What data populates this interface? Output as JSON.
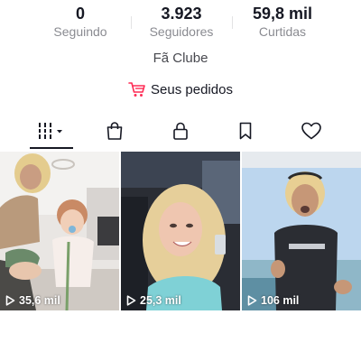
{
  "stats": [
    {
      "value": "0",
      "label": "Seguindo"
    },
    {
      "value": "3.923",
      "label": "Seguidores"
    },
    {
      "value": "59,8 mil",
      "label": "Curtidas"
    }
  ],
  "fan_club": "Fã Clube",
  "orders": {
    "label": "Seus pedidos",
    "icon": "cart-icon",
    "color": "#fe2c55"
  },
  "tabs": [
    {
      "name": "videos-grid",
      "icon": "grid-icon",
      "selected": true
    },
    {
      "name": "shop",
      "icon": "shopping-bag-icon"
    },
    {
      "name": "private",
      "icon": "lock-icon"
    },
    {
      "name": "saved",
      "icon": "bookmark-icon"
    },
    {
      "name": "liked",
      "icon": "heart-icon"
    }
  ],
  "videos": [
    {
      "views": "35,6 mil",
      "icon": "play-icon"
    },
    {
      "views": "25,3 mil",
      "icon": "play-icon"
    },
    {
      "views": "106 mil",
      "icon": "play-icon"
    }
  ]
}
